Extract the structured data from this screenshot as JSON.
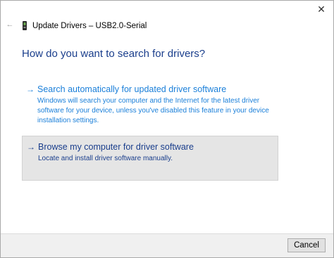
{
  "window": {
    "close_glyph": "✕",
    "back_glyph": "←",
    "title": "Update Drivers – USB2.0-Serial",
    "title_icon": "usb-device-icon"
  },
  "main": {
    "heading": "How do you want to search for drivers?",
    "options": [
      {
        "arrow": "→",
        "title": "Search automatically for updated driver software",
        "description": "Windows will search your computer and the Internet for the latest driver software for your device, unless you've disabled this feature in your device installation settings."
      },
      {
        "arrow": "→",
        "title": "Browse my computer for driver software",
        "description": "Locate and install driver software manually."
      }
    ]
  },
  "footer": {
    "cancel_label": "Cancel"
  },
  "colors": {
    "heading": "#1a3e8c",
    "link": "#1a7fd9",
    "hover_background": "#e5e5e5"
  }
}
